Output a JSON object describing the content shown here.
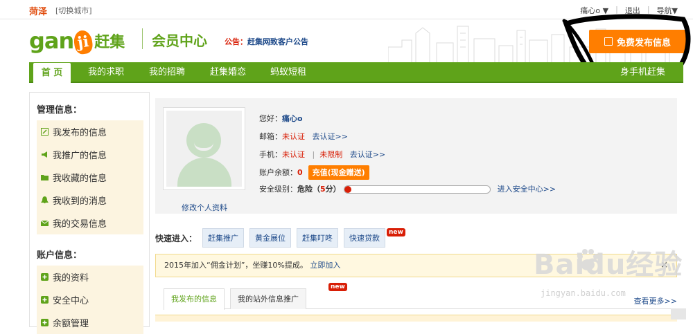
{
  "topbar": {
    "city": "菏泽",
    "switch_city": "[切换城市]",
    "username": "痛心o ▼",
    "logout": "退出",
    "nav_menu": "导航▼"
  },
  "header": {
    "logo_gan": "gan",
    "logo_ji": "ji",
    "logo_cn": "赶集",
    "member_center": "会员中心",
    "notice_label": "公告：",
    "notice_text": "赶集网致客户公告",
    "publish_button": "免费发布信息"
  },
  "nav": {
    "tabs": [
      "首 页",
      "我的求职",
      "我的招聘",
      "赶集婚恋",
      "蚂蚁短租"
    ],
    "right_item": "身手机赶集"
  },
  "sidebar": {
    "manage_title": "管理信息：",
    "manage_items": [
      "我发布的信息",
      "我推广的信息",
      "我收藏的信息",
      "我收到的消息",
      "我的交易信息"
    ],
    "account_title": "账户信息：",
    "account_items": [
      "我的资料",
      "安全中心",
      "余额管理"
    ]
  },
  "profile": {
    "edit_profile": "修改个人资料",
    "greeting_label": "您好：",
    "username": "痛心o",
    "email_label": "邮箱：",
    "email_status": "未认证",
    "email_action": "去认证>>",
    "phone_label": "手机：",
    "phone_status": "未认证",
    "phone_sep": "|",
    "phone_limit": "未限制",
    "phone_action": "去认证>>",
    "balance_label": "账户余额：",
    "balance_value": "0",
    "recharge_button": "充值(现金赠送)",
    "security_label": "安全级别：",
    "security_level": "危险",
    "security_score_open": "（",
    "security_score": "5",
    "security_score_close": "分）",
    "security_progress": 0.05,
    "security_link": "进入安全中心>>"
  },
  "quick": {
    "label": "快速进入：",
    "buttons": [
      "赶集推广",
      "黄金展位",
      "赶集叮咚",
      "快速贷款"
    ],
    "new_badge": "new"
  },
  "promo": {
    "text": "2015年加入“佣金计划”，坐赚10%提成。",
    "link": "立即加入",
    "close": "×"
  },
  "tabs": {
    "items": [
      "我发布的信息",
      "我的站外信息推广"
    ],
    "new_badge": "new",
    "more": "查看更多>>"
  },
  "watermark": {
    "brand": "Baidu经验",
    "url": "jingyan.baidu.com"
  },
  "colors": {
    "brand_green": "#5fa31a",
    "accent_orange": "#ff7e00",
    "alert_red": "#d81e06",
    "link_blue": "#1e4a8a"
  }
}
